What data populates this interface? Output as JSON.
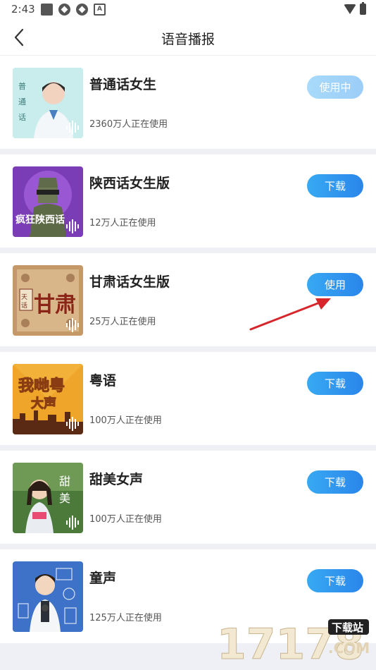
{
  "status_bar": {
    "time": "2:43"
  },
  "header": {
    "title": "语音播报"
  },
  "voices": [
    {
      "title": "普通话女生",
      "users": "2360万人正在使用",
      "button": "使用中",
      "state": "in-use",
      "thumb_text": "普通话",
      "thumb_color": "#bfe6e8"
    },
    {
      "title": "陕西话女生版",
      "users": "12万人正在使用",
      "button": "下载",
      "state": "download",
      "thumb_text": "疯狂陕西话",
      "thumb_color": "#7b3fb2"
    },
    {
      "title": "甘肃话女生版",
      "users": "25万人正在使用",
      "button": "使用",
      "state": "use",
      "thumb_text": "甘肃",
      "thumb_color": "#c89a6a"
    },
    {
      "title": "粤语",
      "users": "100万人正在使用",
      "button": "下载",
      "state": "download",
      "thumb_text": "我哋粤大声",
      "thumb_color": "#e7a32b"
    },
    {
      "title": "甜美女声",
      "users": "100万人正在使用",
      "button": "下载",
      "state": "download",
      "thumb_text": "甜美女声",
      "thumb_color": "#4f7a3d"
    },
    {
      "title": "童声",
      "users": "125万人正在使用",
      "button": "下载",
      "state": "download",
      "thumb_text": "",
      "thumb_color": "#3b6fc4"
    }
  ],
  "watermark": {
    "number": "17178",
    "label": "下载站",
    "domain": ".COM"
  },
  "colors": {
    "accent": "#2a86ea",
    "in_use": "#9bcdf7",
    "separator": "#eef0f5",
    "arrow": "#d7262b"
  }
}
